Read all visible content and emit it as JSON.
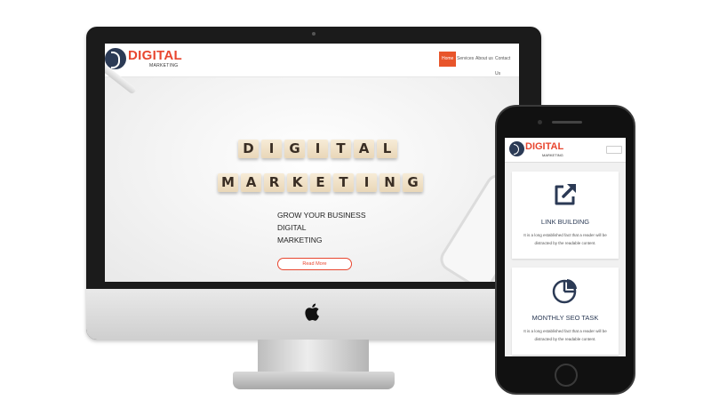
{
  "desktop": {
    "logo": {
      "title": "DIGITAL",
      "subtitle": "MARKETING"
    },
    "nav": [
      {
        "label": "Home",
        "active": true
      },
      {
        "label": "Services",
        "active": false
      },
      {
        "label": "About us",
        "active": false
      },
      {
        "label": "Contact Us",
        "active": false
      }
    ],
    "hero": {
      "tiles_row1": [
        "D",
        "I",
        "G",
        "I",
        "T",
        "A",
        "L"
      ],
      "tiles_row2": [
        "M",
        "A",
        "R",
        "K",
        "E",
        "T",
        "I",
        "N",
        "G"
      ],
      "lines": [
        "GROW YOUR BUSINESS",
        "DIGITAL",
        "MARKETING"
      ],
      "button": "Read More"
    },
    "slider": {
      "count": 3,
      "active_index": 0
    }
  },
  "mobile": {
    "logo": {
      "title": "DIGITAL",
      "subtitle": "MARKETING"
    },
    "cards": [
      {
        "icon": "external-link-icon",
        "title": "LINK BUILDING",
        "text": "It is a long established fact that a reader will be distracted by the readable content."
      },
      {
        "icon": "pie-chart-icon",
        "title": "MONTHLY SEO TASK",
        "text": "It is a long established fact that a reader will be distracted by the readable content."
      }
    ]
  },
  "colors": {
    "accent": "#e8462f",
    "navy": "#2b3a55"
  }
}
